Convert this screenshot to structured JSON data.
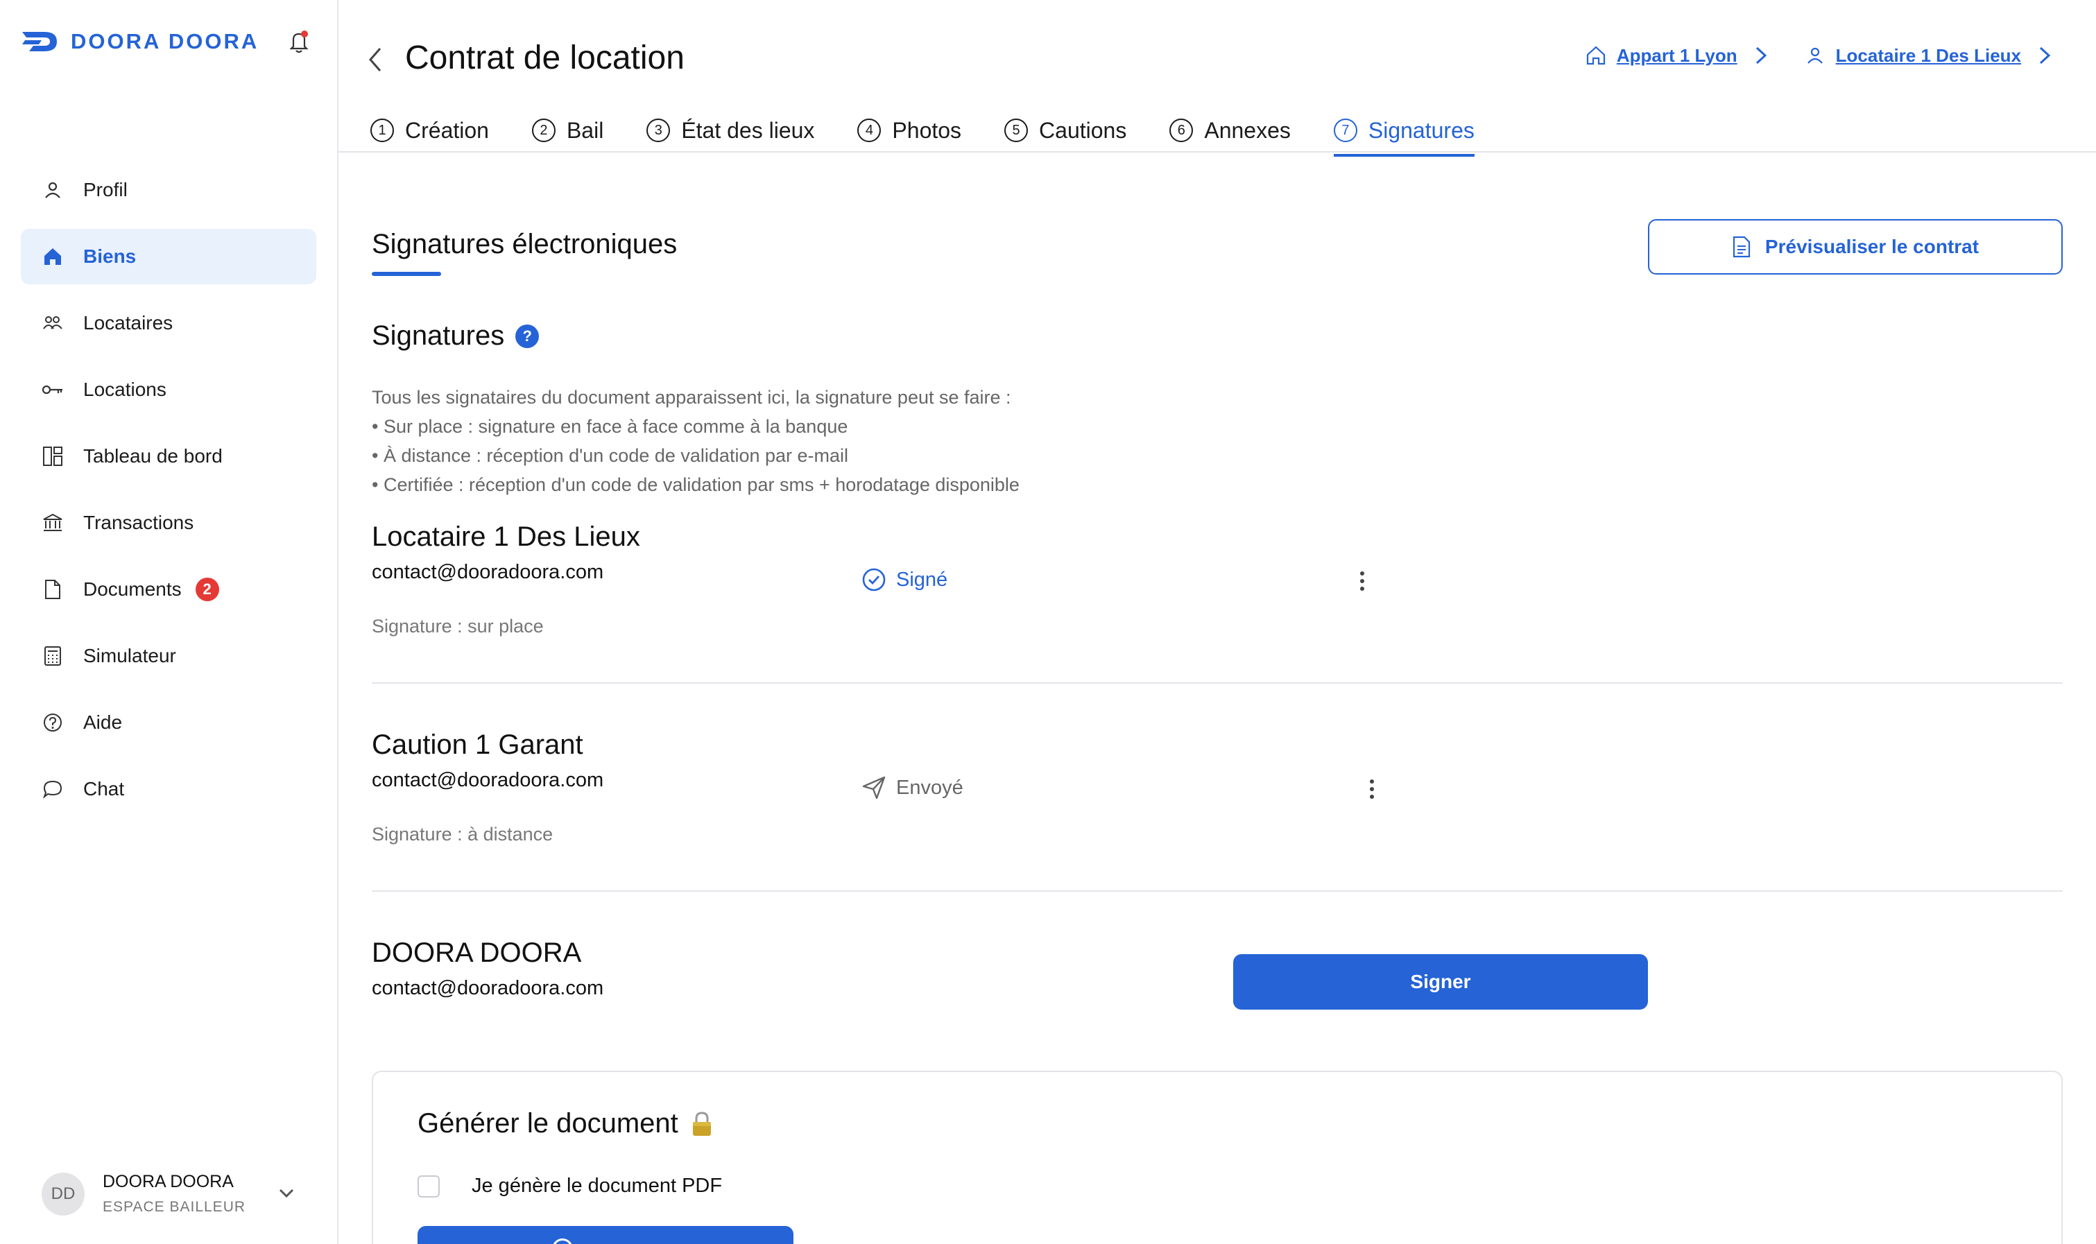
{
  "brand": {
    "name": "DOORA DOORA",
    "accent": "#2563d6"
  },
  "sidebar": {
    "items": [
      {
        "label": "Profil",
        "icon": "user-icon"
      },
      {
        "label": "Biens",
        "icon": "home-icon",
        "active": true
      },
      {
        "label": "Locataires",
        "icon": "people-icon"
      },
      {
        "label": "Locations",
        "icon": "key-icon"
      },
      {
        "label": "Tableau de bord",
        "icon": "dashboard-icon"
      },
      {
        "label": "Transactions",
        "icon": "bank-icon"
      },
      {
        "label": "Documents",
        "icon": "document-icon",
        "badge": "2"
      },
      {
        "label": "Simulateur",
        "icon": "calculator-icon"
      },
      {
        "label": "Aide",
        "icon": "help-icon"
      },
      {
        "label": "Chat",
        "icon": "chat-icon"
      }
    ],
    "user": {
      "initials": "DD",
      "name": "DOORA DOORA",
      "role": "ESPACE BAILLEUR"
    }
  },
  "header": {
    "title": "Contrat de location",
    "breadcrumbs": [
      {
        "label": "Appart 1 Lyon",
        "icon": "home-icon"
      },
      {
        "label": "Locataire 1 Des Lieux",
        "icon": "user-icon"
      }
    ]
  },
  "tabs": [
    {
      "num": "1",
      "label": "Création"
    },
    {
      "num": "2",
      "label": "Bail"
    },
    {
      "num": "3",
      "label": "État des lieux"
    },
    {
      "num": "4",
      "label": "Photos"
    },
    {
      "num": "5",
      "label": "Cautions"
    },
    {
      "num": "6",
      "label": "Annexes"
    },
    {
      "num": "7",
      "label": "Signatures",
      "active": true
    }
  ],
  "main": {
    "section_title": "Signatures électroniques",
    "preview_label": "Prévisualiser le contrat",
    "signatures_heading": "Signatures",
    "help_glyph": "?",
    "info_lines": [
      "Tous les signataires du document apparaissent ici, la signature peut se faire :",
      "• Sur place : signature en face à face comme à la banque",
      "• À distance : réception d'un code de validation par e-mail",
      "• Certifiée : réception d'un code de validation par sms + horodatage disponible"
    ],
    "signers": [
      {
        "name": "Locataire 1 Des Lieux",
        "email": "contact@dooradoora.com",
        "mode": "Signature : sur place",
        "status": "Signé",
        "status_color": "#2563d6"
      },
      {
        "name": "Caution 1 Garant",
        "email": "contact@dooradoora.com",
        "mode": "Signature : à distance",
        "status": "Envoyé",
        "status_color": "#666666"
      },
      {
        "name": "DOORA DOORA",
        "email": "contact@dooradoora.com",
        "action": "Signer"
      }
    ],
    "generate": {
      "title": "Générer le document",
      "checkbox_label": "Je génère le document PDF",
      "checked": false
    }
  }
}
